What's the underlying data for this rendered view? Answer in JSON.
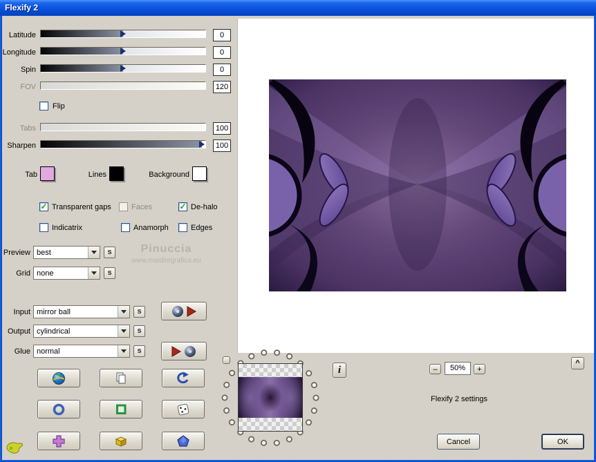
{
  "titlebar": {
    "title": "Flexify 2"
  },
  "sliders": [
    {
      "label": "Latitude",
      "value": "0",
      "disabled": false,
      "position_pct": 50
    },
    {
      "label": "Longitude",
      "value": "0",
      "disabled": false,
      "position_pct": 50
    },
    {
      "label": "Spin",
      "value": "0",
      "disabled": false,
      "position_pct": 50
    },
    {
      "label": "FOV",
      "value": "120",
      "disabled": true,
      "position_pct": 0
    },
    {
      "label": "Tabs",
      "value": "100",
      "disabled": true,
      "position_pct": 0
    },
    {
      "label": "Sharpen",
      "value": "100",
      "disabled": false,
      "position_pct": 98
    }
  ],
  "flip": {
    "label": "Flip",
    "checked": false
  },
  "swatches": [
    {
      "label": "Tab",
      "color": "#e3a8df"
    },
    {
      "label": "Lines",
      "color": "#000000"
    },
    {
      "label": "Background",
      "color": "#ffffff"
    }
  ],
  "checkboxes": [
    {
      "label": "Transparent gaps",
      "checked": true,
      "disabled": false
    },
    {
      "label": "Faces",
      "checked": false,
      "disabled": true
    },
    {
      "label": "De-halo",
      "checked": true,
      "disabled": false
    },
    {
      "label": "Indicatrix",
      "checked": false,
      "disabled": false
    },
    {
      "label": "Anamorph",
      "checked": false,
      "disabled": false
    },
    {
      "label": "Edges",
      "checked": false,
      "disabled": false
    }
  ],
  "dropdowns": [
    {
      "label": "Preview",
      "value": "best"
    },
    {
      "label": "Grid",
      "value": "none"
    },
    {
      "label": "Input",
      "value": "mirror ball"
    },
    {
      "label": "Output",
      "value": "cylindrical"
    },
    {
      "label": "Glue",
      "value": "normal"
    }
  ],
  "icons": {
    "check": "✓",
    "seed": "s",
    "info": "i",
    "collapse": "^"
  },
  "watermark": {
    "name": "Pinuccia",
    "url": "www.maidiregrafica.eu"
  },
  "zoom": {
    "out": "–",
    "value": "50%",
    "in": "+"
  },
  "status": {
    "text": "Flexify 2 settings"
  },
  "actions": {
    "cancel": "Cancel",
    "ok": "OK"
  },
  "theme": {
    "titlebar_blue": "#0b52dc",
    "frame_blue": "#0a45c4",
    "panel_gray": "#d5d1c8",
    "tab_swatch_pink": "#e3a8df"
  }
}
